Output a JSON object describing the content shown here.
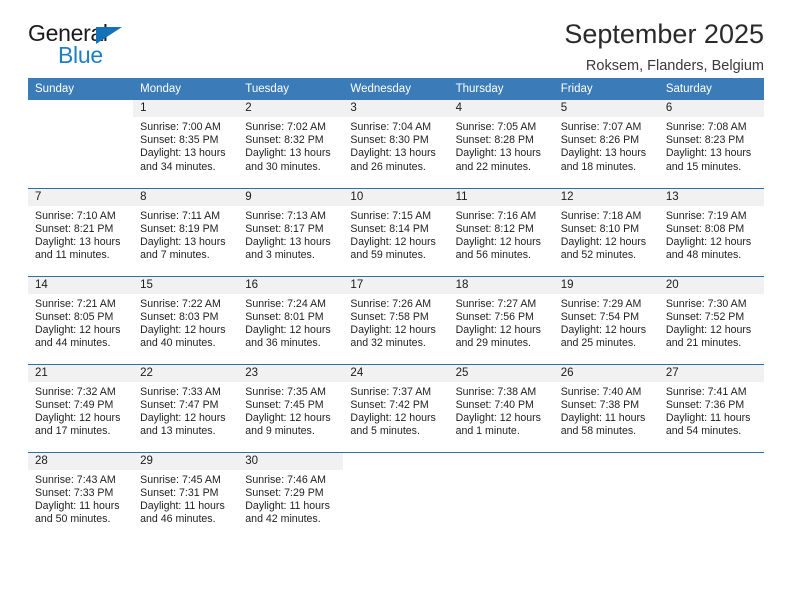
{
  "brand": {
    "name_top": "General",
    "name_bottom": "Blue",
    "triangle_color": "#1372b8",
    "blue": "#1f7fc4"
  },
  "header": {
    "title": "September 2025",
    "subtitle": "Roksem, Flanders, Belgium"
  },
  "theme": {
    "header_bg": "#3b7cb8",
    "row_divider": "#2f6fa8",
    "daynum_bg": "#f1f1f1"
  },
  "weekdays": [
    "Sunday",
    "Monday",
    "Tuesday",
    "Wednesday",
    "Thursday",
    "Friday",
    "Saturday"
  ],
  "weeks": [
    [
      {
        "day": "",
        "lines": []
      },
      {
        "day": "1",
        "lines": [
          "Sunrise: 7:00 AM",
          "Sunset: 8:35 PM",
          "Daylight: 13 hours",
          "and 34 minutes."
        ]
      },
      {
        "day": "2",
        "lines": [
          "Sunrise: 7:02 AM",
          "Sunset: 8:32 PM",
          "Daylight: 13 hours",
          "and 30 minutes."
        ]
      },
      {
        "day": "3",
        "lines": [
          "Sunrise: 7:04 AM",
          "Sunset: 8:30 PM",
          "Daylight: 13 hours",
          "and 26 minutes."
        ]
      },
      {
        "day": "4",
        "lines": [
          "Sunrise: 7:05 AM",
          "Sunset: 8:28 PM",
          "Daylight: 13 hours",
          "and 22 minutes."
        ]
      },
      {
        "day": "5",
        "lines": [
          "Sunrise: 7:07 AM",
          "Sunset: 8:26 PM",
          "Daylight: 13 hours",
          "and 18 minutes."
        ]
      },
      {
        "day": "6",
        "lines": [
          "Sunrise: 7:08 AM",
          "Sunset: 8:23 PM",
          "Daylight: 13 hours",
          "and 15 minutes."
        ]
      }
    ],
    [
      {
        "day": "7",
        "lines": [
          "Sunrise: 7:10 AM",
          "Sunset: 8:21 PM",
          "Daylight: 13 hours",
          "and 11 minutes."
        ]
      },
      {
        "day": "8",
        "lines": [
          "Sunrise: 7:11 AM",
          "Sunset: 8:19 PM",
          "Daylight: 13 hours",
          "and 7 minutes."
        ]
      },
      {
        "day": "9",
        "lines": [
          "Sunrise: 7:13 AM",
          "Sunset: 8:17 PM",
          "Daylight: 13 hours",
          "and 3 minutes."
        ]
      },
      {
        "day": "10",
        "lines": [
          "Sunrise: 7:15 AM",
          "Sunset: 8:14 PM",
          "Daylight: 12 hours",
          "and 59 minutes."
        ]
      },
      {
        "day": "11",
        "lines": [
          "Sunrise: 7:16 AM",
          "Sunset: 8:12 PM",
          "Daylight: 12 hours",
          "and 56 minutes."
        ]
      },
      {
        "day": "12",
        "lines": [
          "Sunrise: 7:18 AM",
          "Sunset: 8:10 PM",
          "Daylight: 12 hours",
          "and 52 minutes."
        ]
      },
      {
        "day": "13",
        "lines": [
          "Sunrise: 7:19 AM",
          "Sunset: 8:08 PM",
          "Daylight: 12 hours",
          "and 48 minutes."
        ]
      }
    ],
    [
      {
        "day": "14",
        "lines": [
          "Sunrise: 7:21 AM",
          "Sunset: 8:05 PM",
          "Daylight: 12 hours",
          "and 44 minutes."
        ]
      },
      {
        "day": "15",
        "lines": [
          "Sunrise: 7:22 AM",
          "Sunset: 8:03 PM",
          "Daylight: 12 hours",
          "and 40 minutes."
        ]
      },
      {
        "day": "16",
        "lines": [
          "Sunrise: 7:24 AM",
          "Sunset: 8:01 PM",
          "Daylight: 12 hours",
          "and 36 minutes."
        ]
      },
      {
        "day": "17",
        "lines": [
          "Sunrise: 7:26 AM",
          "Sunset: 7:58 PM",
          "Daylight: 12 hours",
          "and 32 minutes."
        ]
      },
      {
        "day": "18",
        "lines": [
          "Sunrise: 7:27 AM",
          "Sunset: 7:56 PM",
          "Daylight: 12 hours",
          "and 29 minutes."
        ]
      },
      {
        "day": "19",
        "lines": [
          "Sunrise: 7:29 AM",
          "Sunset: 7:54 PM",
          "Daylight: 12 hours",
          "and 25 minutes."
        ]
      },
      {
        "day": "20",
        "lines": [
          "Sunrise: 7:30 AM",
          "Sunset: 7:52 PM",
          "Daylight: 12 hours",
          "and 21 minutes."
        ]
      }
    ],
    [
      {
        "day": "21",
        "lines": [
          "Sunrise: 7:32 AM",
          "Sunset: 7:49 PM",
          "Daylight: 12 hours",
          "and 17 minutes."
        ]
      },
      {
        "day": "22",
        "lines": [
          "Sunrise: 7:33 AM",
          "Sunset: 7:47 PM",
          "Daylight: 12 hours",
          "and 13 minutes."
        ]
      },
      {
        "day": "23",
        "lines": [
          "Sunrise: 7:35 AM",
          "Sunset: 7:45 PM",
          "Daylight: 12 hours",
          "and 9 minutes."
        ]
      },
      {
        "day": "24",
        "lines": [
          "Sunrise: 7:37 AM",
          "Sunset: 7:42 PM",
          "Daylight: 12 hours",
          "and 5 minutes."
        ]
      },
      {
        "day": "25",
        "lines": [
          "Sunrise: 7:38 AM",
          "Sunset: 7:40 PM",
          "Daylight: 12 hours",
          "and 1 minute."
        ]
      },
      {
        "day": "26",
        "lines": [
          "Sunrise: 7:40 AM",
          "Sunset: 7:38 PM",
          "Daylight: 11 hours",
          "and 58 minutes."
        ]
      },
      {
        "day": "27",
        "lines": [
          "Sunrise: 7:41 AM",
          "Sunset: 7:36 PM",
          "Daylight: 11 hours",
          "and 54 minutes."
        ]
      }
    ],
    [
      {
        "day": "28",
        "lines": [
          "Sunrise: 7:43 AM",
          "Sunset: 7:33 PM",
          "Daylight: 11 hours",
          "and 50 minutes."
        ]
      },
      {
        "day": "29",
        "lines": [
          "Sunrise: 7:45 AM",
          "Sunset: 7:31 PM",
          "Daylight: 11 hours",
          "and 46 minutes."
        ]
      },
      {
        "day": "30",
        "lines": [
          "Sunrise: 7:46 AM",
          "Sunset: 7:29 PM",
          "Daylight: 11 hours",
          "and 42 minutes."
        ]
      },
      {
        "day": "",
        "lines": []
      },
      {
        "day": "",
        "lines": []
      },
      {
        "day": "",
        "lines": []
      },
      {
        "day": "",
        "lines": []
      }
    ]
  ]
}
